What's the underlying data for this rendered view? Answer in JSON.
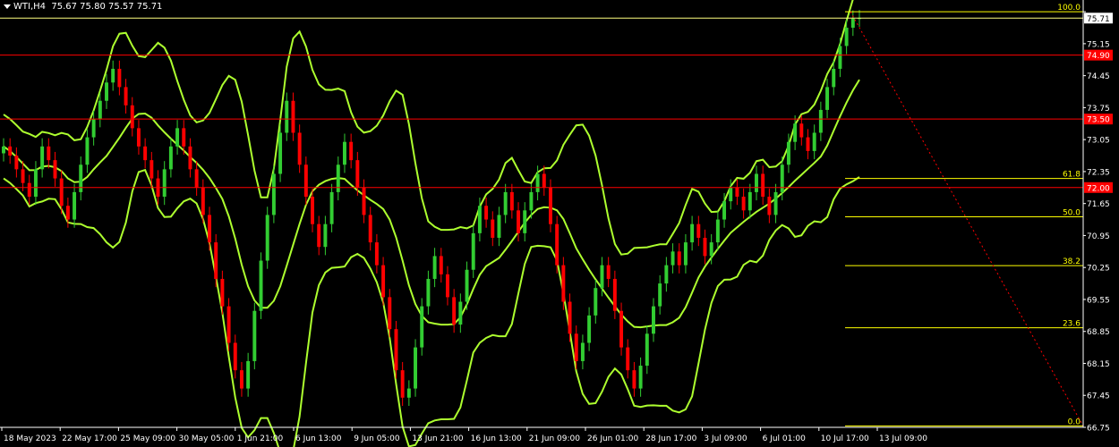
{
  "header": {
    "symbol_text": "WTI,H4",
    "ohlc_text": "75.67 75.80 75.57 75.71"
  },
  "colors": {
    "background": "#000000",
    "bull": "#32cd32",
    "bear": "#ff0000",
    "bands": "#adff2f",
    "levels": "#ff0000",
    "fib": "#ffff00",
    "price_line": "#ffff80",
    "axis_text": "#ffffff"
  },
  "chart_data": {
    "type": "candlestick",
    "title": "WTI,H4",
    "ylim": [
      66.75,
      75.95
    ],
    "y_ticks": [
      "75.85",
      "75.15",
      "74.45",
      "73.75",
      "73.05",
      "72.35",
      "71.65",
      "70.95",
      "70.25",
      "69.55",
      "68.85",
      "68.15",
      "67.45",
      "66.75"
    ],
    "x_ticks": [
      "18 May 2023",
      "22 May 17:00",
      "25 May 09:00",
      "30 May 05:00",
      "1 Jun 21:00",
      "6 Jun 13:00",
      "9 Jun 05:00",
      "13 Jun 21:00",
      "16 Jun 13:00",
      "21 Jun 09:00",
      "26 Jun 01:00",
      "28 Jun 17:00",
      "3 Jul 09:00",
      "6 Jul 01:00",
      "10 Jul 17:00",
      "13 Jul 09:00"
    ],
    "current_price": 75.71,
    "horizontal_levels": [
      {
        "value": 74.9,
        "label": "74.90"
      },
      {
        "value": 73.5,
        "label": "73.50"
      },
      {
        "value": 72.0,
        "label": "72.00"
      }
    ],
    "fibonacci": [
      {
        "label": "100.0",
        "value": 75.85
      },
      {
        "label": "61.8",
        "value": 72.2
      },
      {
        "label": "50.0",
        "value": 71.36
      },
      {
        "label": "38.2",
        "value": 70.29
      },
      {
        "label": "23.6",
        "value": 68.93
      },
      {
        "label": "0.0",
        "value": 66.78
      }
    ],
    "closes": [
      72.9,
      72.7,
      72.4,
      72.1,
      71.8,
      72.4,
      72.9,
      72.6,
      72.2,
      71.6,
      71.3,
      71.9,
      72.5,
      73.1,
      73.5,
      73.9,
      74.3,
      74.6,
      74.2,
      73.8,
      73.3,
      72.9,
      72.6,
      72.2,
      71.8,
      72.4,
      72.9,
      73.3,
      72.9,
      72.4,
      72.0,
      71.4,
      70.8,
      70.0,
      69.4,
      68.6,
      68.0,
      67.6,
      68.2,
      69.3,
      70.4,
      71.4,
      72.3,
      73.2,
      73.9,
      73.2,
      72.5,
      71.8,
      71.2,
      70.7,
      71.2,
      71.9,
      72.5,
      73.0,
      72.6,
      72.0,
      71.4,
      70.8,
      70.3,
      69.6,
      68.9,
      68.0,
      67.4,
      67.6,
      68.5,
      69.4,
      70.0,
      70.5,
      70.1,
      69.6,
      69.0,
      69.5,
      70.2,
      71.0,
      71.6,
      71.3,
      70.9,
      71.4,
      71.9,
      71.5,
      71.0,
      71.5,
      71.9,
      72.3,
      72.0,
      71.2,
      70.3,
      69.5,
      68.8,
      68.2,
      68.6,
      69.2,
      69.8,
      70.3,
      70.0,
      69.3,
      68.5,
      68.0,
      67.6,
      68.1,
      68.8,
      69.4,
      69.9,
      70.3,
      70.6,
      70.3,
      70.8,
      71.2,
      70.9,
      70.5,
      70.8,
      71.3,
      71.7,
      72.0,
      71.8,
      71.5,
      71.9,
      72.3,
      71.8,
      71.4,
      71.9,
      72.5,
      73.0,
      73.4,
      73.1,
      72.8,
      73.2,
      73.7,
      74.2,
      74.6,
      75.1,
      75.5,
      75.7,
      75.71
    ]
  }
}
